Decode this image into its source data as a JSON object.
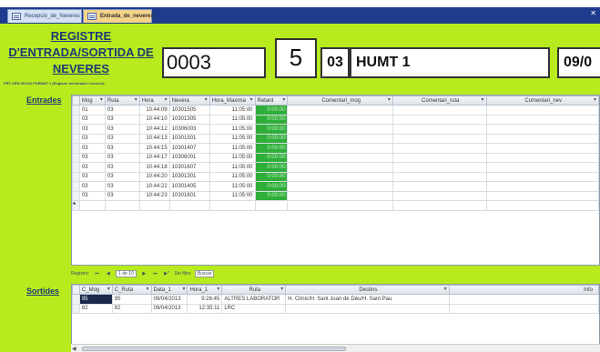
{
  "tabs": [
    {
      "label": "Recepcio_de_Neveres"
    },
    {
      "label": "Entrada_de_neveres"
    }
  ],
  "header": {
    "title": "REGISTRE D'ENTRADA/SORTIDA DE NEVERES",
    "subtitle": "PRT-VER-001/04 FORMAT 1 (Registre m/entrada i neveres)",
    "code": "0003",
    "number": "5",
    "route_code": "03",
    "route_name": "HUMT 1",
    "date": "09/0"
  },
  "entrades": {
    "label": "Entrades",
    "columns": [
      "Mog",
      "Ruta",
      "Hora",
      "Nevera",
      "Hora_Maxima",
      "Retard",
      "Comentari_mog",
      "Comentari_ruta",
      "Comentari_nev"
    ],
    "rows": [
      {
        "mog": "01",
        "ruta": "03",
        "hora": "10:44:09",
        "nevera": "10301505",
        "hora_maxima": "11:05:00",
        "retard": "0:00:00"
      },
      {
        "mog": "03",
        "ruta": "03",
        "hora": "10:44:10",
        "nevera": "10301305",
        "hora_maxima": "11:05:00",
        "retard": "0:00:00"
      },
      {
        "mog": "03",
        "ruta": "03",
        "hora": "10:44:12",
        "nevera": "10306003",
        "hora_maxima": "11:05:00",
        "retard": "0:00:00"
      },
      {
        "mog": "03",
        "ruta": "03",
        "hora": "10:44:13",
        "nevera": "10301501",
        "hora_maxima": "11:05:00",
        "retard": "0:00:00"
      },
      {
        "mog": "03",
        "ruta": "03",
        "hora": "10:44:15",
        "nevera": "10301407",
        "hora_maxima": "11:05:00",
        "retard": "0:00:00"
      },
      {
        "mog": "03",
        "ruta": "03",
        "hora": "10:44:17",
        "nevera": "10306001",
        "hora_maxima": "11:05:00",
        "retard": "0:00:00"
      },
      {
        "mog": "03",
        "ruta": "03",
        "hora": "10:44:18",
        "nevera": "10301607",
        "hora_maxima": "11:05:00",
        "retard": "0:00:00"
      },
      {
        "mog": "03",
        "ruta": "03",
        "hora": "10:44:20",
        "nevera": "10301301",
        "hora_maxima": "11:05:00",
        "retard": "0:00:00"
      },
      {
        "mog": "03",
        "ruta": "03",
        "hora": "10:44:22",
        "nevera": "10301405",
        "hora_maxima": "11:05:00",
        "retard": "0:00:00"
      },
      {
        "mog": "03",
        "ruta": "03",
        "hora": "10:44:23",
        "nevera": "10301601",
        "hora_maxima": "11:05:00",
        "retard": "0:00:00"
      }
    ],
    "new_row_marker": "*"
  },
  "navigator": {
    "label": "Registre:",
    "position": "1 de 10",
    "filter": "Sin filtro",
    "search": "Buscar"
  },
  "sortides": {
    "label": "Sortides",
    "columns": [
      "C_Mog",
      "C_Ruta",
      "Data_1",
      "Hora_1",
      "Ruta",
      "Destins",
      "Info"
    ],
    "rows": [
      {
        "c_mog": "95",
        "c_ruta": "95",
        "data": "09/04/2013",
        "hora": "9:26:45",
        "ruta": "ALTRES LABORATOR",
        "destins": "H. Clínic/H. Sant Joan de Déu/H. Sant Pau",
        "info": ""
      },
      {
        "c_mog": "82",
        "c_ruta": "82",
        "data": "09/04/2013",
        "hora": "12:35:11",
        "ruta": "LRC",
        "destins": "",
        "info": ""
      }
    ]
  },
  "colors": {
    "form_bg": "#b7eb1e",
    "retard_green": "#2fae3a",
    "title_blue": "#1f3a74",
    "tabbar_blue": "#1d3c8d"
  }
}
